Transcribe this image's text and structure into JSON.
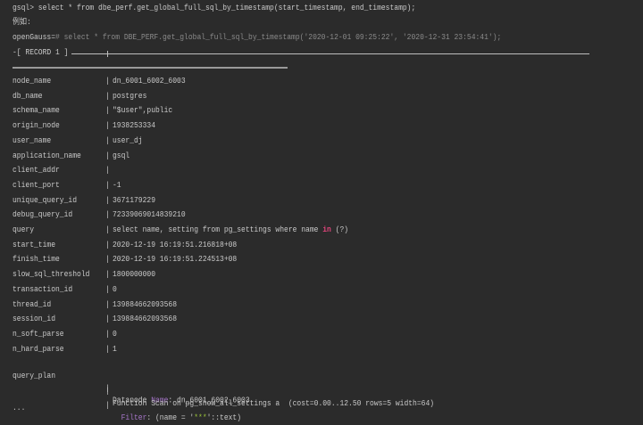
{
  "syntax_line": "gsql> select * from dbe_perf.get_global_full_sql_by_timestamp(start_timestamp, end_timestamp);",
  "example_label": "例如:",
  "example_prompt": "openGauss=",
  "example_cmd": "# select * from DBE_PERF.get_global_full_sql_by_timestamp('2020-12-01 09:25:22', '2020-12-31 23:54:41');",
  "record_header": "-[ RECORD 1 ]",
  "separator": "|",
  "rows": [
    {
      "key": "node_name",
      "value": "dn_6001_6002_6003"
    },
    {
      "key": "db_name",
      "value": "postgres"
    },
    {
      "key": "schema_name",
      "value": "\"$user\",public"
    },
    {
      "key": "origin_node",
      "value": "1938253334"
    },
    {
      "key": "user_name",
      "value": "user_dj"
    },
    {
      "key": "application_name",
      "value": "gsql"
    },
    {
      "key": "client_addr",
      "value": ""
    },
    {
      "key": "client_port",
      "value": "-1"
    },
    {
      "key": "unique_query_id",
      "value": "3671179229"
    },
    {
      "key": "debug_query_id",
      "value": "72339069014839210"
    },
    {
      "key": "query",
      "value": "select name, setting from pg_settings where name ",
      "keyword": "in",
      "value_tail": " (?)"
    },
    {
      "key": "start_time",
      "value": "2020-12-19 16:19:51.216818+08"
    },
    {
      "key": "finish_time",
      "value": "2020-12-19 16:19:51.224513+08"
    },
    {
      "key": "slow_sql_threshold",
      "value": "1800000000"
    },
    {
      "key": "transaction_id",
      "value": "0"
    },
    {
      "key": "thread_id",
      "value": "139884662093568"
    },
    {
      "key": "session_id",
      "value": "139884662093568"
    },
    {
      "key": "n_soft_parse",
      "value": "0"
    },
    {
      "key": "n_hard_parse",
      "value": "1"
    }
  ],
  "query_plan": {
    "key": "query_plan",
    "line1_a": "Datanode ",
    "line1_kw": "Name",
    "line1_b": ": dn_6001_6002_6003",
    "line2": "Function Scan on pg_show_all_settings a  (cost=0.00..12.50 rows=5 width=64)",
    "line3_kw": "  Filter",
    "line3_a": ": (name = '",
    "line3_str": "***",
    "line3_b": "'::text)"
  },
  "ellipsis": "..."
}
